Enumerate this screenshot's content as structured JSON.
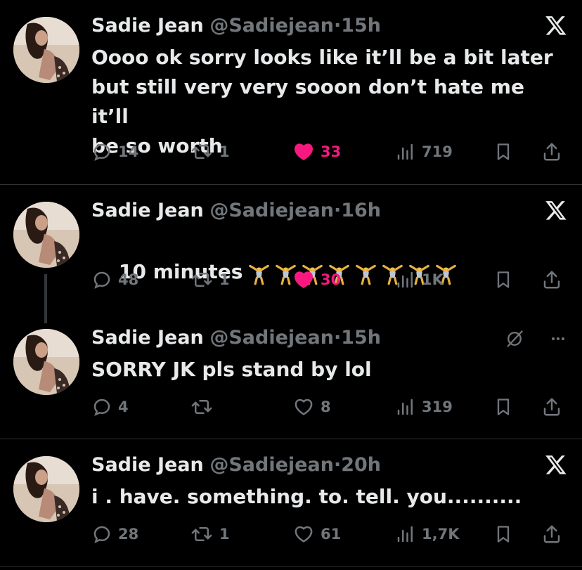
{
  "colors": {
    "background": "#000000",
    "text_primary": "#e7e9ea",
    "text_secondary": "#71767b",
    "like_active": "#f91880",
    "divider": "#2f3336"
  },
  "tweets": [
    {
      "name": "Sadie Jean",
      "handle": "@Sadiejean",
      "separator": "·",
      "time": "15h",
      "text": "Oooo ok sorry looks like it’ll be a bit later\nbut still very very sooon don’t hate me it’ll\nbe so worth",
      "emoji": "",
      "corner_icon": "x-logo-icon",
      "replies": "14",
      "reposts": "1",
      "likes": "33",
      "liked": true,
      "views": "719"
    },
    {
      "name": "Sadie Jean",
      "handle": "@Sadiejean",
      "separator": "·",
      "time": "16h",
      "text": "10 minutes",
      "emoji": "🤸🤸🤸🤸🤸🤸🤸🤸",
      "corner_icon": "x-logo-icon",
      "replies": "48",
      "reposts": "1",
      "likes": "30",
      "liked": true,
      "views": "1K"
    },
    {
      "name": "Sadie Jean",
      "handle": "@Sadiejean",
      "separator": "·",
      "time": "15h",
      "text": "SORRY JK pls stand by lol",
      "emoji": "",
      "corner_icon": "mute-icon",
      "more_icon": "more-icon",
      "replies": "4",
      "reposts": "",
      "likes": "8",
      "liked": false,
      "views": "319"
    },
    {
      "name": "Sadie Jean",
      "handle": "@Sadiejean",
      "separator": "·",
      "time": "20h",
      "text": "i . have. something. to. tell. you..........",
      "emoji": "",
      "corner_icon": "x-logo-icon",
      "replies": "28",
      "reposts": "1",
      "likes": "61",
      "liked": false,
      "views": "1,7K"
    }
  ]
}
